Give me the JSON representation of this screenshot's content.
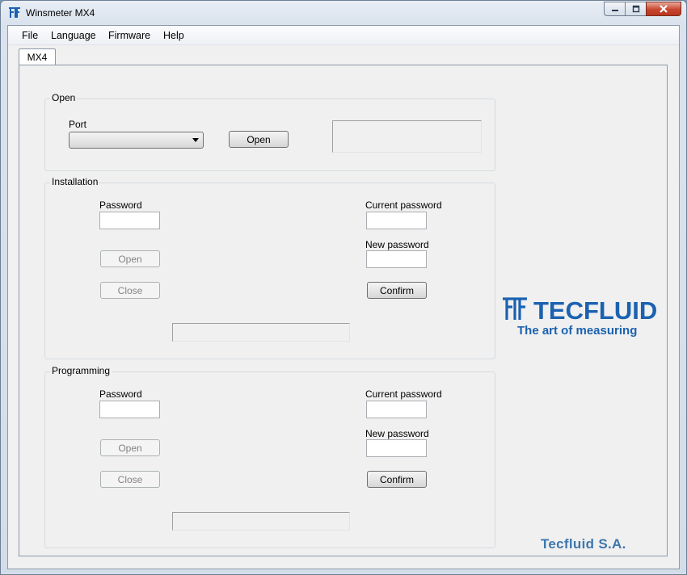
{
  "window": {
    "title": "Winsmeter MX4",
    "controls": {
      "minimize_icon": "minimize-icon",
      "maximize_icon": "maximize-icon",
      "close_icon": "close-icon"
    }
  },
  "menu": [
    "File",
    "Language",
    "Firmware",
    "Help"
  ],
  "tabs": [
    {
      "label": "MX4",
      "selected": true
    }
  ],
  "open_group": {
    "title": "Open",
    "port_label": "Port",
    "port_value": "",
    "open_button": "Open",
    "status": ""
  },
  "installation": {
    "title": "Installation",
    "password_label": "Password",
    "password_value": "",
    "open_button": "Open",
    "close_button": "Close",
    "current_password_label": "Current password",
    "current_password_value": "",
    "new_password_label": "New password",
    "new_password_value": "",
    "confirm_button": "Confirm",
    "status": ""
  },
  "programming": {
    "title": "Programming",
    "password_label": "Password",
    "password_value": "",
    "open_button": "Open",
    "close_button": "Close",
    "current_password_label": "Current password",
    "current_password_value": "",
    "new_password_label": "New password",
    "new_password_value": "",
    "confirm_button": "Confirm",
    "status": ""
  },
  "branding": {
    "logo_text": "TECFLUID",
    "tagline": "The art of measuring",
    "company": "Tecfluid S.A.",
    "brand_color": "#1b62b0"
  }
}
